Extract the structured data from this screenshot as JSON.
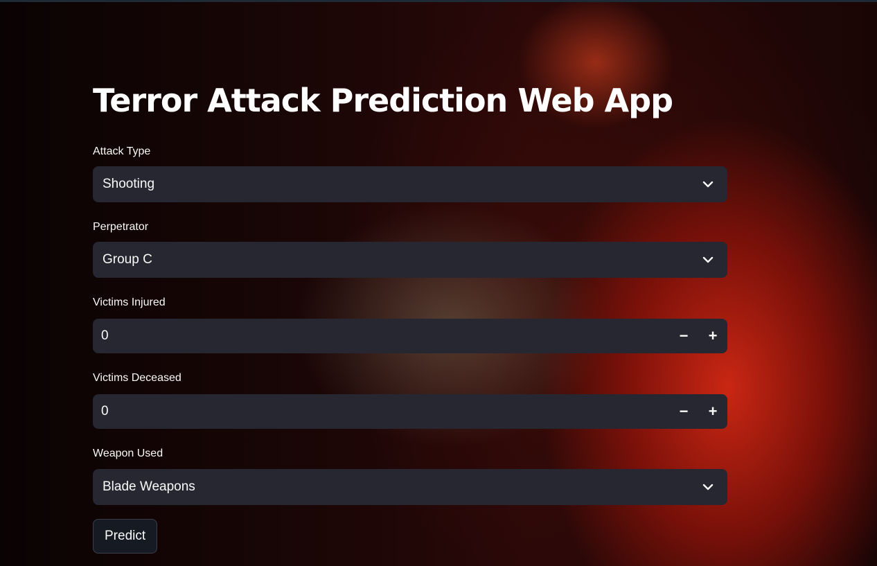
{
  "app": {
    "title": "Terror Attack Prediction Web App"
  },
  "form": {
    "attack_type": {
      "label": "Attack Type",
      "value": "Shooting"
    },
    "perpetrator": {
      "label": "Perpetrator",
      "value": "Group C"
    },
    "victims_injured": {
      "label": "Victims Injured",
      "value": "0",
      "decrement": "−",
      "increment": "+"
    },
    "victims_deceased": {
      "label": "Victims Deceased",
      "value": "0",
      "decrement": "−",
      "increment": "+"
    },
    "weapon_used": {
      "label": "Weapon Used",
      "value": "Blade Weapons"
    },
    "predict_label": "Predict"
  },
  "icons": {
    "dropdown": "chevron-down-icon",
    "decrement": "minus-icon",
    "increment": "plus-icon"
  },
  "colors": {
    "input_bg": "#262730",
    "text": "#fafafa",
    "button_bg": "#161a22",
    "button_border": "#3d404c"
  }
}
